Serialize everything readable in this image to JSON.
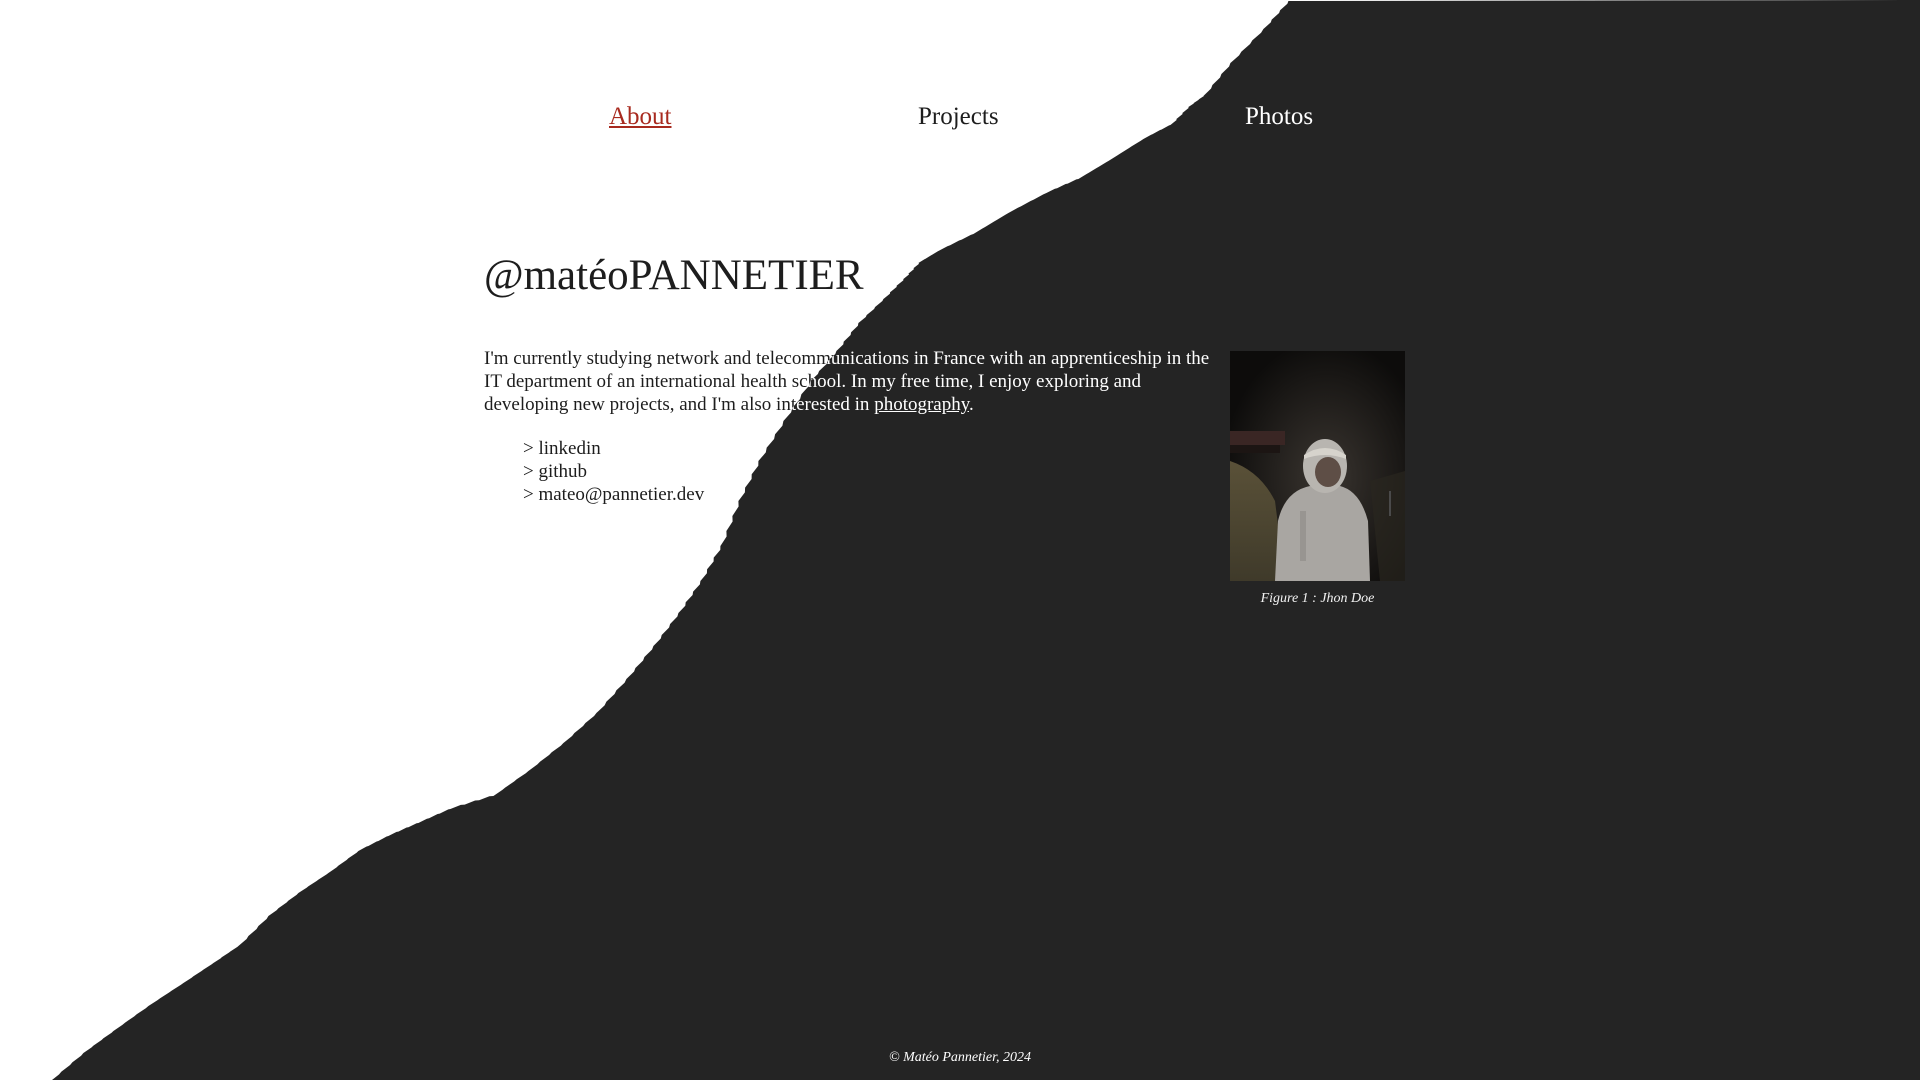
{
  "colors": {
    "background_light": "#ffffff",
    "background_dark": "#242424",
    "text_dark": "#1d1d1d",
    "text_light": "#ffffff",
    "accent_active": "#a82a1f"
  },
  "nav": {
    "items": [
      {
        "label": "About",
        "active": true
      },
      {
        "label": "Projects",
        "active": false
      },
      {
        "label": "Photos",
        "active": false
      }
    ]
  },
  "main": {
    "title": "@matéoPANNETIER",
    "intro_text": "I'm currently studying network and telecommunications in France with an apprenticeship in the IT department of an international health school. In my free time, I enjoy exploring and developing new projects, and I'm also interested in ",
    "intro_link": "photography",
    "intro_end": ".",
    "links": [
      {
        "label": "> linkedin"
      },
      {
        "label": "> github"
      },
      {
        "label": "> mateo@pannetier.dev"
      }
    ]
  },
  "figure": {
    "caption": "Figure 1 : Jhon Doe"
  },
  "footer": {
    "text": "© Matéo Pannetier, 2024"
  }
}
